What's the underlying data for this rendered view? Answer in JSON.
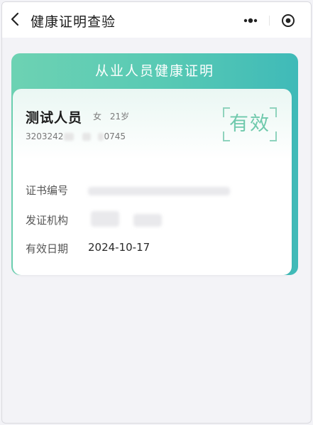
{
  "navbar": {
    "title": "健康证明查验",
    "back_icon": "chevron-left-icon",
    "more_icon": "more-dots-icon",
    "close_icon": "target-circle-icon"
  },
  "card": {
    "header_title": "从业人员健康证明",
    "person_name": "测试人员",
    "gender": "女",
    "age": "21岁",
    "id_prefix": "3203242",
    "id_suffix": "0745",
    "status_stamp": "有效",
    "fields": [
      {
        "label": "证书编号",
        "value": ""
      },
      {
        "label": "发证机构",
        "value": ""
      },
      {
        "label": "有效日期",
        "value": "2024-10-17"
      }
    ]
  },
  "colors": {
    "header_gradient_start": "#6dd2b3",
    "header_gradient_end": "#3fbab8",
    "stamp": "#6fc9ac",
    "page_bg": "#f3f3f7"
  }
}
